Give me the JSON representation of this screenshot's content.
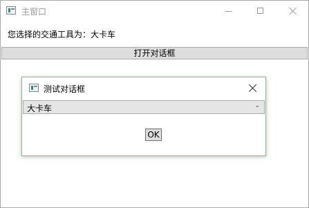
{
  "main_window": {
    "title": "主窗口",
    "selection_label": "您选择的交通工具为：大卡车",
    "open_dialog_button": "打开对话框"
  },
  "dialog": {
    "title": "测试对话框",
    "vehicle_select": {
      "selected": "大卡车"
    },
    "ok_button": "OK"
  },
  "icons": {
    "app": "app-icon",
    "minimize": "minimize-icon",
    "maximize": "maximize-icon",
    "close": "close-icon",
    "dropdown": "chevron-down-icon"
  },
  "colors": {
    "button_bg": "#dddddd",
    "dialog_border": "#8db58d",
    "title_inactive": "#999999"
  }
}
